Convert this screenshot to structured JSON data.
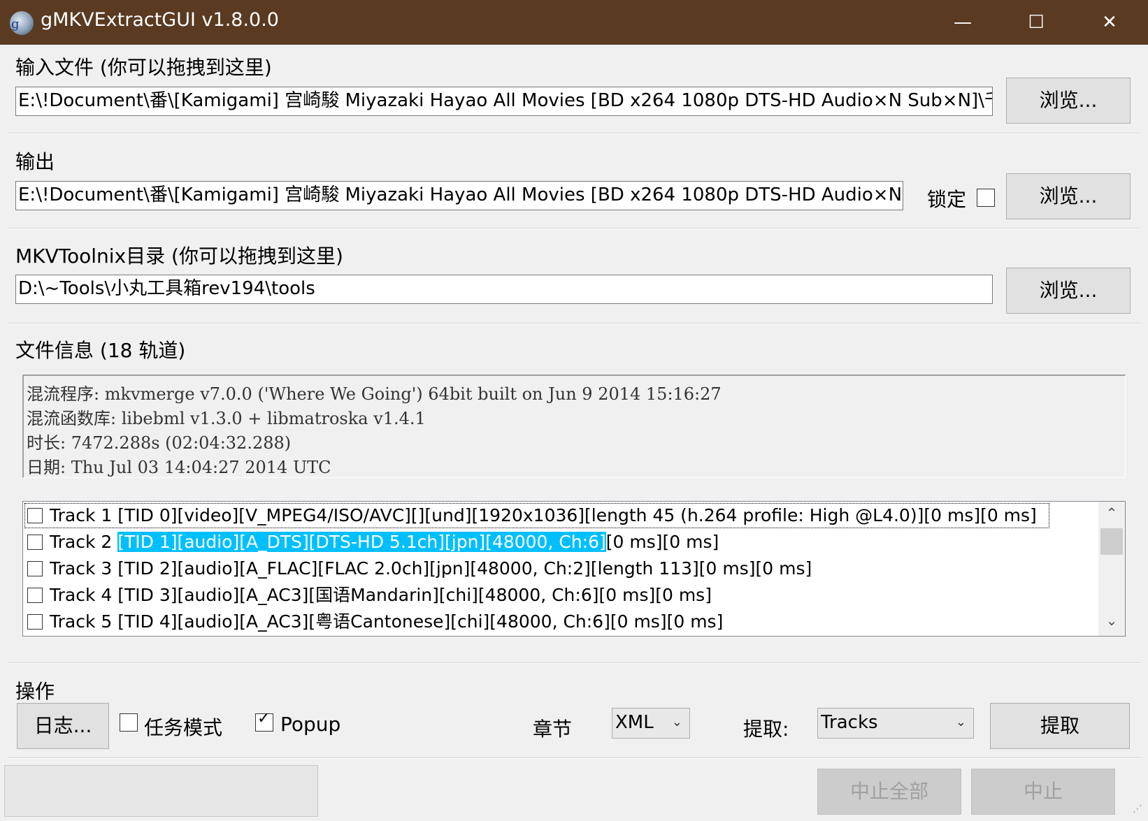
{
  "window": {
    "icon": "gmkv-app-icon",
    "title": "gMKVExtractGUI v1.8.0.0",
    "minimize_glyph": "—",
    "maximize_glyph": "☐",
    "close_glyph": "✕"
  },
  "input": {
    "label": "输入文件 (你可以拖拽到这里)",
    "value": "E:\\!Document\\番\\[Kamigami] 宫崎駿 Miyazaki Hayao All Movies [BD x264 1080p DTS-HD Audio×N Sub×N]\\千と千尋",
    "browse_label": "浏览..."
  },
  "output": {
    "label": "输出",
    "value": "E:\\!Document\\番\\[Kamigami] 宫崎駿 Miyazaki Hayao All Movies [BD x264 1080p DTS-HD Audio×N Sub×N",
    "lock_label": "锁定",
    "lock_checked": false,
    "browse_label": "浏览..."
  },
  "mkvtoolnix": {
    "label": "MKVToolnix目录 (你可以拖拽到这里)",
    "value": "D:\\~Tools\\小丸工具箱rev194\\tools",
    "browse_label": "浏览..."
  },
  "file_info": {
    "label": "文件信息 (18 轨道)",
    "lines": [
      "混流程序: mkvmerge v7.0.0 ('Where We Going') 64bit built on Jun  9 2014 15:16:27",
      "混流函数库: libebml v1.3.0 + libmatroska v1.4.1",
      "时长: 7472.288s (02:04:32.288)",
      "日期: Thu Jul 03 14:04:27 2014 UTC"
    ]
  },
  "tracks": [
    {
      "prefix": "Track 1 ",
      "highlight": "",
      "suffix": "[TID 0][video][V_MPEG4/ISO/AVC][][und][1920x1036][length 45 (h.264 profile: High @L4.0)][0 ms][0 ms]",
      "checked": false
    },
    {
      "prefix": "Track 2 ",
      "highlight": "[TID 1][audio][A_DTS][DTS-HD 5.1ch][jpn][48000, Ch:6]",
      "suffix": "[0 ms][0 ms]",
      "checked": false
    },
    {
      "prefix": "Track 3 ",
      "highlight": "",
      "suffix": "[TID 2][audio][A_FLAC][FLAC 2.0ch][jpn][48000, Ch:2][length 113][0 ms][0 ms]",
      "checked": false
    },
    {
      "prefix": "Track 4 ",
      "highlight": "",
      "suffix": "[TID 3][audio][A_AC3][国语Mandarin][chi][48000, Ch:6][0 ms][0 ms]",
      "checked": false
    },
    {
      "prefix": "Track 5 ",
      "highlight": "",
      "suffix": "[TID 4][audio][A_AC3][粤语Cantonese][chi][48000, Ch:6][0 ms][0 ms]",
      "checked": false
    }
  ],
  "scrollbar": {
    "up_glyph": "⌃",
    "down_glyph": "⌄"
  },
  "actions": {
    "label": "操作",
    "log_button": "日志...",
    "job_mode_label": "任务模式",
    "job_mode_checked": false,
    "popup_label": "Popup",
    "popup_checked": true,
    "chapters_label": "章节",
    "chapters_value": "XML",
    "extract_label": "提取:",
    "extract_value": "Tracks",
    "extract_button": "提取"
  },
  "status": {
    "abort_all_label": "中止全部",
    "abort_label": "中止"
  }
}
